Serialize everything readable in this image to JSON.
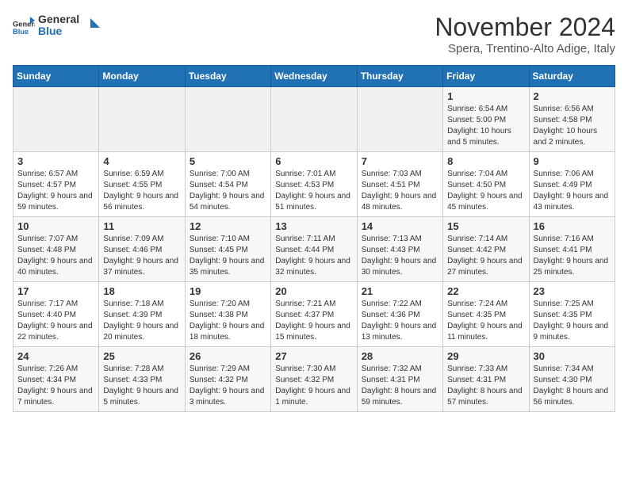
{
  "logo": {
    "general": "General",
    "blue": "Blue"
  },
  "header": {
    "month": "November 2024",
    "location": "Spera, Trentino-Alto Adige, Italy"
  },
  "days_of_week": [
    "Sunday",
    "Monday",
    "Tuesday",
    "Wednesday",
    "Thursday",
    "Friday",
    "Saturday"
  ],
  "weeks": [
    [
      {
        "day": "",
        "info": ""
      },
      {
        "day": "",
        "info": ""
      },
      {
        "day": "",
        "info": ""
      },
      {
        "day": "",
        "info": ""
      },
      {
        "day": "",
        "info": ""
      },
      {
        "day": "1",
        "info": "Sunrise: 6:54 AM\nSunset: 5:00 PM\nDaylight: 10 hours and 5 minutes."
      },
      {
        "day": "2",
        "info": "Sunrise: 6:56 AM\nSunset: 4:58 PM\nDaylight: 10 hours and 2 minutes."
      }
    ],
    [
      {
        "day": "3",
        "info": "Sunrise: 6:57 AM\nSunset: 4:57 PM\nDaylight: 9 hours and 59 minutes."
      },
      {
        "day": "4",
        "info": "Sunrise: 6:59 AM\nSunset: 4:55 PM\nDaylight: 9 hours and 56 minutes."
      },
      {
        "day": "5",
        "info": "Sunrise: 7:00 AM\nSunset: 4:54 PM\nDaylight: 9 hours and 54 minutes."
      },
      {
        "day": "6",
        "info": "Sunrise: 7:01 AM\nSunset: 4:53 PM\nDaylight: 9 hours and 51 minutes."
      },
      {
        "day": "7",
        "info": "Sunrise: 7:03 AM\nSunset: 4:51 PM\nDaylight: 9 hours and 48 minutes."
      },
      {
        "day": "8",
        "info": "Sunrise: 7:04 AM\nSunset: 4:50 PM\nDaylight: 9 hours and 45 minutes."
      },
      {
        "day": "9",
        "info": "Sunrise: 7:06 AM\nSunset: 4:49 PM\nDaylight: 9 hours and 43 minutes."
      }
    ],
    [
      {
        "day": "10",
        "info": "Sunrise: 7:07 AM\nSunset: 4:48 PM\nDaylight: 9 hours and 40 minutes."
      },
      {
        "day": "11",
        "info": "Sunrise: 7:09 AM\nSunset: 4:46 PM\nDaylight: 9 hours and 37 minutes."
      },
      {
        "day": "12",
        "info": "Sunrise: 7:10 AM\nSunset: 4:45 PM\nDaylight: 9 hours and 35 minutes."
      },
      {
        "day": "13",
        "info": "Sunrise: 7:11 AM\nSunset: 4:44 PM\nDaylight: 9 hours and 32 minutes."
      },
      {
        "day": "14",
        "info": "Sunrise: 7:13 AM\nSunset: 4:43 PM\nDaylight: 9 hours and 30 minutes."
      },
      {
        "day": "15",
        "info": "Sunrise: 7:14 AM\nSunset: 4:42 PM\nDaylight: 9 hours and 27 minutes."
      },
      {
        "day": "16",
        "info": "Sunrise: 7:16 AM\nSunset: 4:41 PM\nDaylight: 9 hours and 25 minutes."
      }
    ],
    [
      {
        "day": "17",
        "info": "Sunrise: 7:17 AM\nSunset: 4:40 PM\nDaylight: 9 hours and 22 minutes."
      },
      {
        "day": "18",
        "info": "Sunrise: 7:18 AM\nSunset: 4:39 PM\nDaylight: 9 hours and 20 minutes."
      },
      {
        "day": "19",
        "info": "Sunrise: 7:20 AM\nSunset: 4:38 PM\nDaylight: 9 hours and 18 minutes."
      },
      {
        "day": "20",
        "info": "Sunrise: 7:21 AM\nSunset: 4:37 PM\nDaylight: 9 hours and 15 minutes."
      },
      {
        "day": "21",
        "info": "Sunrise: 7:22 AM\nSunset: 4:36 PM\nDaylight: 9 hours and 13 minutes."
      },
      {
        "day": "22",
        "info": "Sunrise: 7:24 AM\nSunset: 4:35 PM\nDaylight: 9 hours and 11 minutes."
      },
      {
        "day": "23",
        "info": "Sunrise: 7:25 AM\nSunset: 4:35 PM\nDaylight: 9 hours and 9 minutes."
      }
    ],
    [
      {
        "day": "24",
        "info": "Sunrise: 7:26 AM\nSunset: 4:34 PM\nDaylight: 9 hours and 7 minutes."
      },
      {
        "day": "25",
        "info": "Sunrise: 7:28 AM\nSunset: 4:33 PM\nDaylight: 9 hours and 5 minutes."
      },
      {
        "day": "26",
        "info": "Sunrise: 7:29 AM\nSunset: 4:32 PM\nDaylight: 9 hours and 3 minutes."
      },
      {
        "day": "27",
        "info": "Sunrise: 7:30 AM\nSunset: 4:32 PM\nDaylight: 9 hours and 1 minute."
      },
      {
        "day": "28",
        "info": "Sunrise: 7:32 AM\nSunset: 4:31 PM\nDaylight: 8 hours and 59 minutes."
      },
      {
        "day": "29",
        "info": "Sunrise: 7:33 AM\nSunset: 4:31 PM\nDaylight: 8 hours and 57 minutes."
      },
      {
        "day": "30",
        "info": "Sunrise: 7:34 AM\nSunset: 4:30 PM\nDaylight: 8 hours and 56 minutes."
      }
    ]
  ]
}
